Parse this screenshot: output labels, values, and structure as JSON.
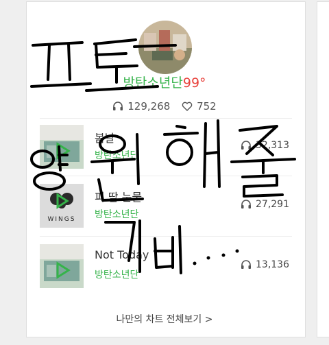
{
  "header": {
    "artist_name": "방탄소년단",
    "station_number": "99°",
    "play_count": "129,268",
    "like_count": "752"
  },
  "tracks": [
    {
      "title": "봄날",
      "artist": "방탄소년단",
      "plays": "32,313",
      "thumb_icon": "you-never-walk-alone-cover"
    },
    {
      "title": "피 땀 눈물",
      "artist": "방탄소년단",
      "plays": "27,291",
      "thumb_icon": "wings-cover",
      "thumb_text": "WINGS"
    },
    {
      "title": "Not Today",
      "artist": "방탄소년단",
      "plays": "13,136",
      "thumb_icon": "you-never-walk-alone-cover"
    }
  ],
  "footer": {
    "more_label": "나만의 차트 전체보기 >"
  },
  "colors": {
    "accent_green": "#35b34a",
    "degree_red": "#e8423c",
    "ink": "#000000"
  }
}
